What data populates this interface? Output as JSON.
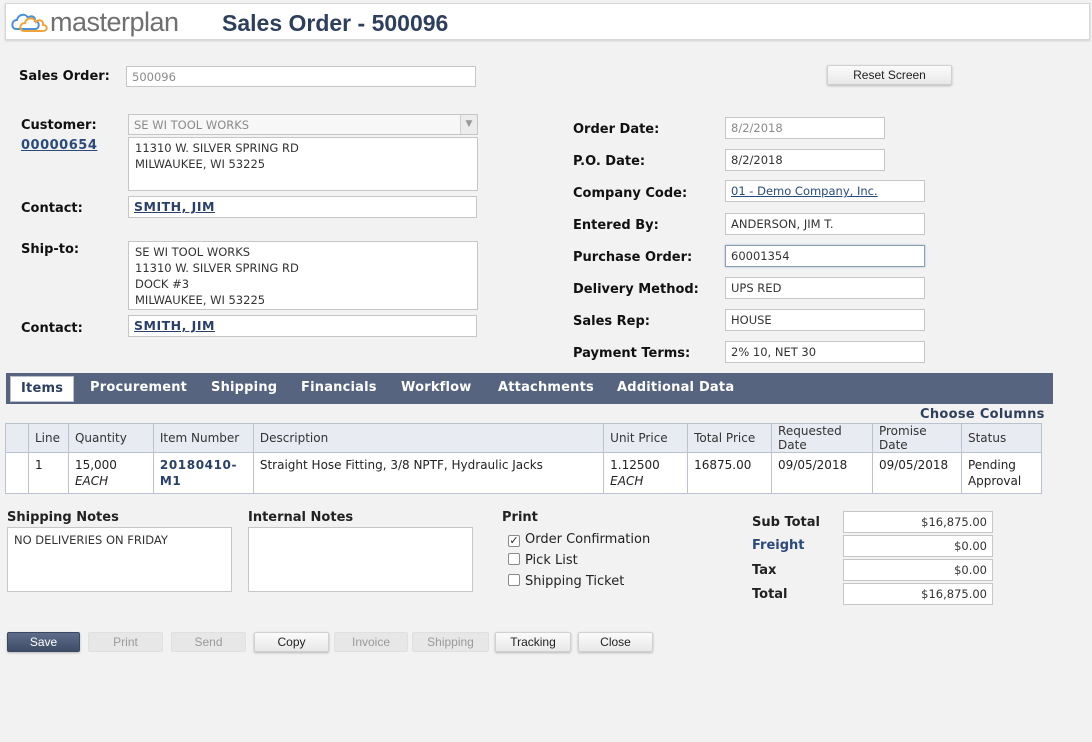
{
  "app": {
    "logo_text": "masterplan",
    "page_title": "Sales Order - 500096"
  },
  "toolbar": {
    "reset_label": "Reset Screen"
  },
  "sales_order": {
    "label": "Sales Order:",
    "value": "500096"
  },
  "customer": {
    "label": "Customer:",
    "number": "00000654",
    "name": "SE WI TOOL WORKS",
    "address_lines": [
      "11310 W. SILVER SPRING RD",
      "MILWAUKEE, WI  53225"
    ],
    "contact_label": "Contact:",
    "contact": "SMITH, JIM"
  },
  "ship_to": {
    "label": "Ship-to:",
    "address_lines": [
      "SE WI TOOL WORKS",
      "11310 W. SILVER SPRING RD",
      "DOCK #3",
      "MILWAUKEE, WI  53225"
    ],
    "contact_label": "Contact:",
    "contact": "SMITH, JIM"
  },
  "order_info": {
    "order_date": {
      "label": "Order Date:",
      "value": "8/2/2018"
    },
    "po_date": {
      "label": "P.O. Date:",
      "value": "8/2/2018"
    },
    "company_code": {
      "label": "Company Code:",
      "value": "01 - Demo Company, Inc."
    },
    "entered_by": {
      "label": "Entered By:",
      "value": "ANDERSON, JIM T."
    },
    "purchase_order": {
      "label": "Purchase Order:",
      "value": "60001354"
    },
    "delivery_method": {
      "label": "Delivery Method:",
      "value": "UPS RED"
    },
    "sales_rep": {
      "label": "Sales Rep:",
      "value": "HOUSE"
    },
    "payment_terms": {
      "label": "Payment Terms:",
      "value": "2% 10, NET 30"
    }
  },
  "tabs": [
    "Items",
    "Procurement",
    "Shipping",
    "Financials",
    "Workflow",
    "Attachments",
    "Additional Data"
  ],
  "choose_columns": "Choose Columns",
  "items_table": {
    "headers": [
      "Line",
      "Quantity",
      "Item Number",
      "Description",
      "Unit Price",
      "Total Price",
      "Requested Date",
      "Promise Date",
      "Status"
    ],
    "rows": [
      {
        "line": "1",
        "quantity": "15,000",
        "quantity_unit": "EACH",
        "item_number_1": "20180410-",
        "item_number_2": "M1",
        "description": "Straight Hose Fitting, 3/8 NPTF, Hydraulic Jacks",
        "unit_price": "1.12500",
        "price_unit": "EACH",
        "total_price": "16875.00",
        "requested_date": "09/05/2018",
        "promise_date": "09/05/2018",
        "status_1": "Pending",
        "status_2": "Approval"
      }
    ]
  },
  "shipping_notes": {
    "title": "Shipping Notes",
    "value": "NO DELIVERIES ON FRIDAY"
  },
  "internal_notes": {
    "title": "Internal Notes",
    "value": ""
  },
  "print": {
    "title": "Print",
    "options": [
      {
        "label": "Order Confirmation",
        "checked": true
      },
      {
        "label": "Pick List",
        "checked": false
      },
      {
        "label": "Shipping Ticket",
        "checked": false
      }
    ]
  },
  "totals": {
    "subtotal": {
      "label": "Sub Total",
      "value": "$16,875.00"
    },
    "freight": {
      "label": "Freight",
      "value": "$0.00"
    },
    "tax": {
      "label": "Tax",
      "value": "$0.00"
    },
    "total": {
      "label": "Total",
      "value": "$16,875.00"
    }
  },
  "actions": {
    "save": "Save",
    "print": "Print",
    "send": "Send",
    "copy": "Copy",
    "invoice": "Invoice",
    "shipping": "Shipping",
    "tracking": "Tracking",
    "close": "Close"
  },
  "colors": {
    "brand": "#2e3f5e",
    "tab_bar": "#57647f",
    "link": "#2a4a7c",
    "logo_orange": "#f2a33a",
    "logo_blue": "#4a90d9"
  }
}
